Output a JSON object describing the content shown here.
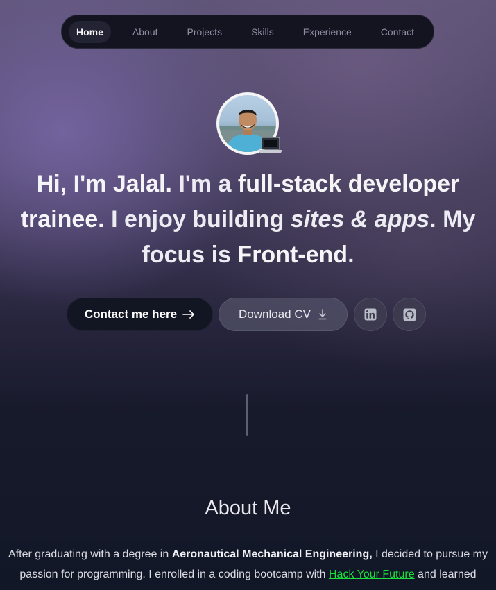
{
  "nav": {
    "items": [
      {
        "label": "Home",
        "active": true
      },
      {
        "label": "About",
        "active": false
      },
      {
        "label": "Projects",
        "active": false
      },
      {
        "label": "Skills",
        "active": false
      },
      {
        "label": "Experience",
        "active": false
      },
      {
        "label": "Contact",
        "active": false
      }
    ]
  },
  "hero": {
    "avatar_badge_icon": "laptop-icon",
    "headline": {
      "greeting": "Hi, I'm Jalal.",
      "text1": " I'm a ",
      "role": "full-stack developer trainee.",
      "text2": " I enjoy building ",
      "emph": "sites & apps",
      "text3": ". My focus is ",
      "focus": "Front-end",
      "text4": "."
    },
    "buttons": {
      "contact_label": "Contact me here",
      "contact_icon": "arrow-right-icon",
      "cv_label": "Download CV",
      "cv_icon": "download-icon",
      "linkedin_icon": "linkedin-icon",
      "github_icon": "github-icon"
    }
  },
  "about": {
    "title": "About Me",
    "p1": "After graduating with a degree in ",
    "degree": "Aeronautical Mechanical Engineering,",
    "p2": " I decided to pursue my passion for programming. I enrolled in a coding bootcamp with ",
    "link": "Hack Your Future",
    "p3": " and learned"
  },
  "colors": {
    "accent_link": "#19e23a",
    "nav_bg": "#13141f",
    "button_dark": "#121522"
  }
}
